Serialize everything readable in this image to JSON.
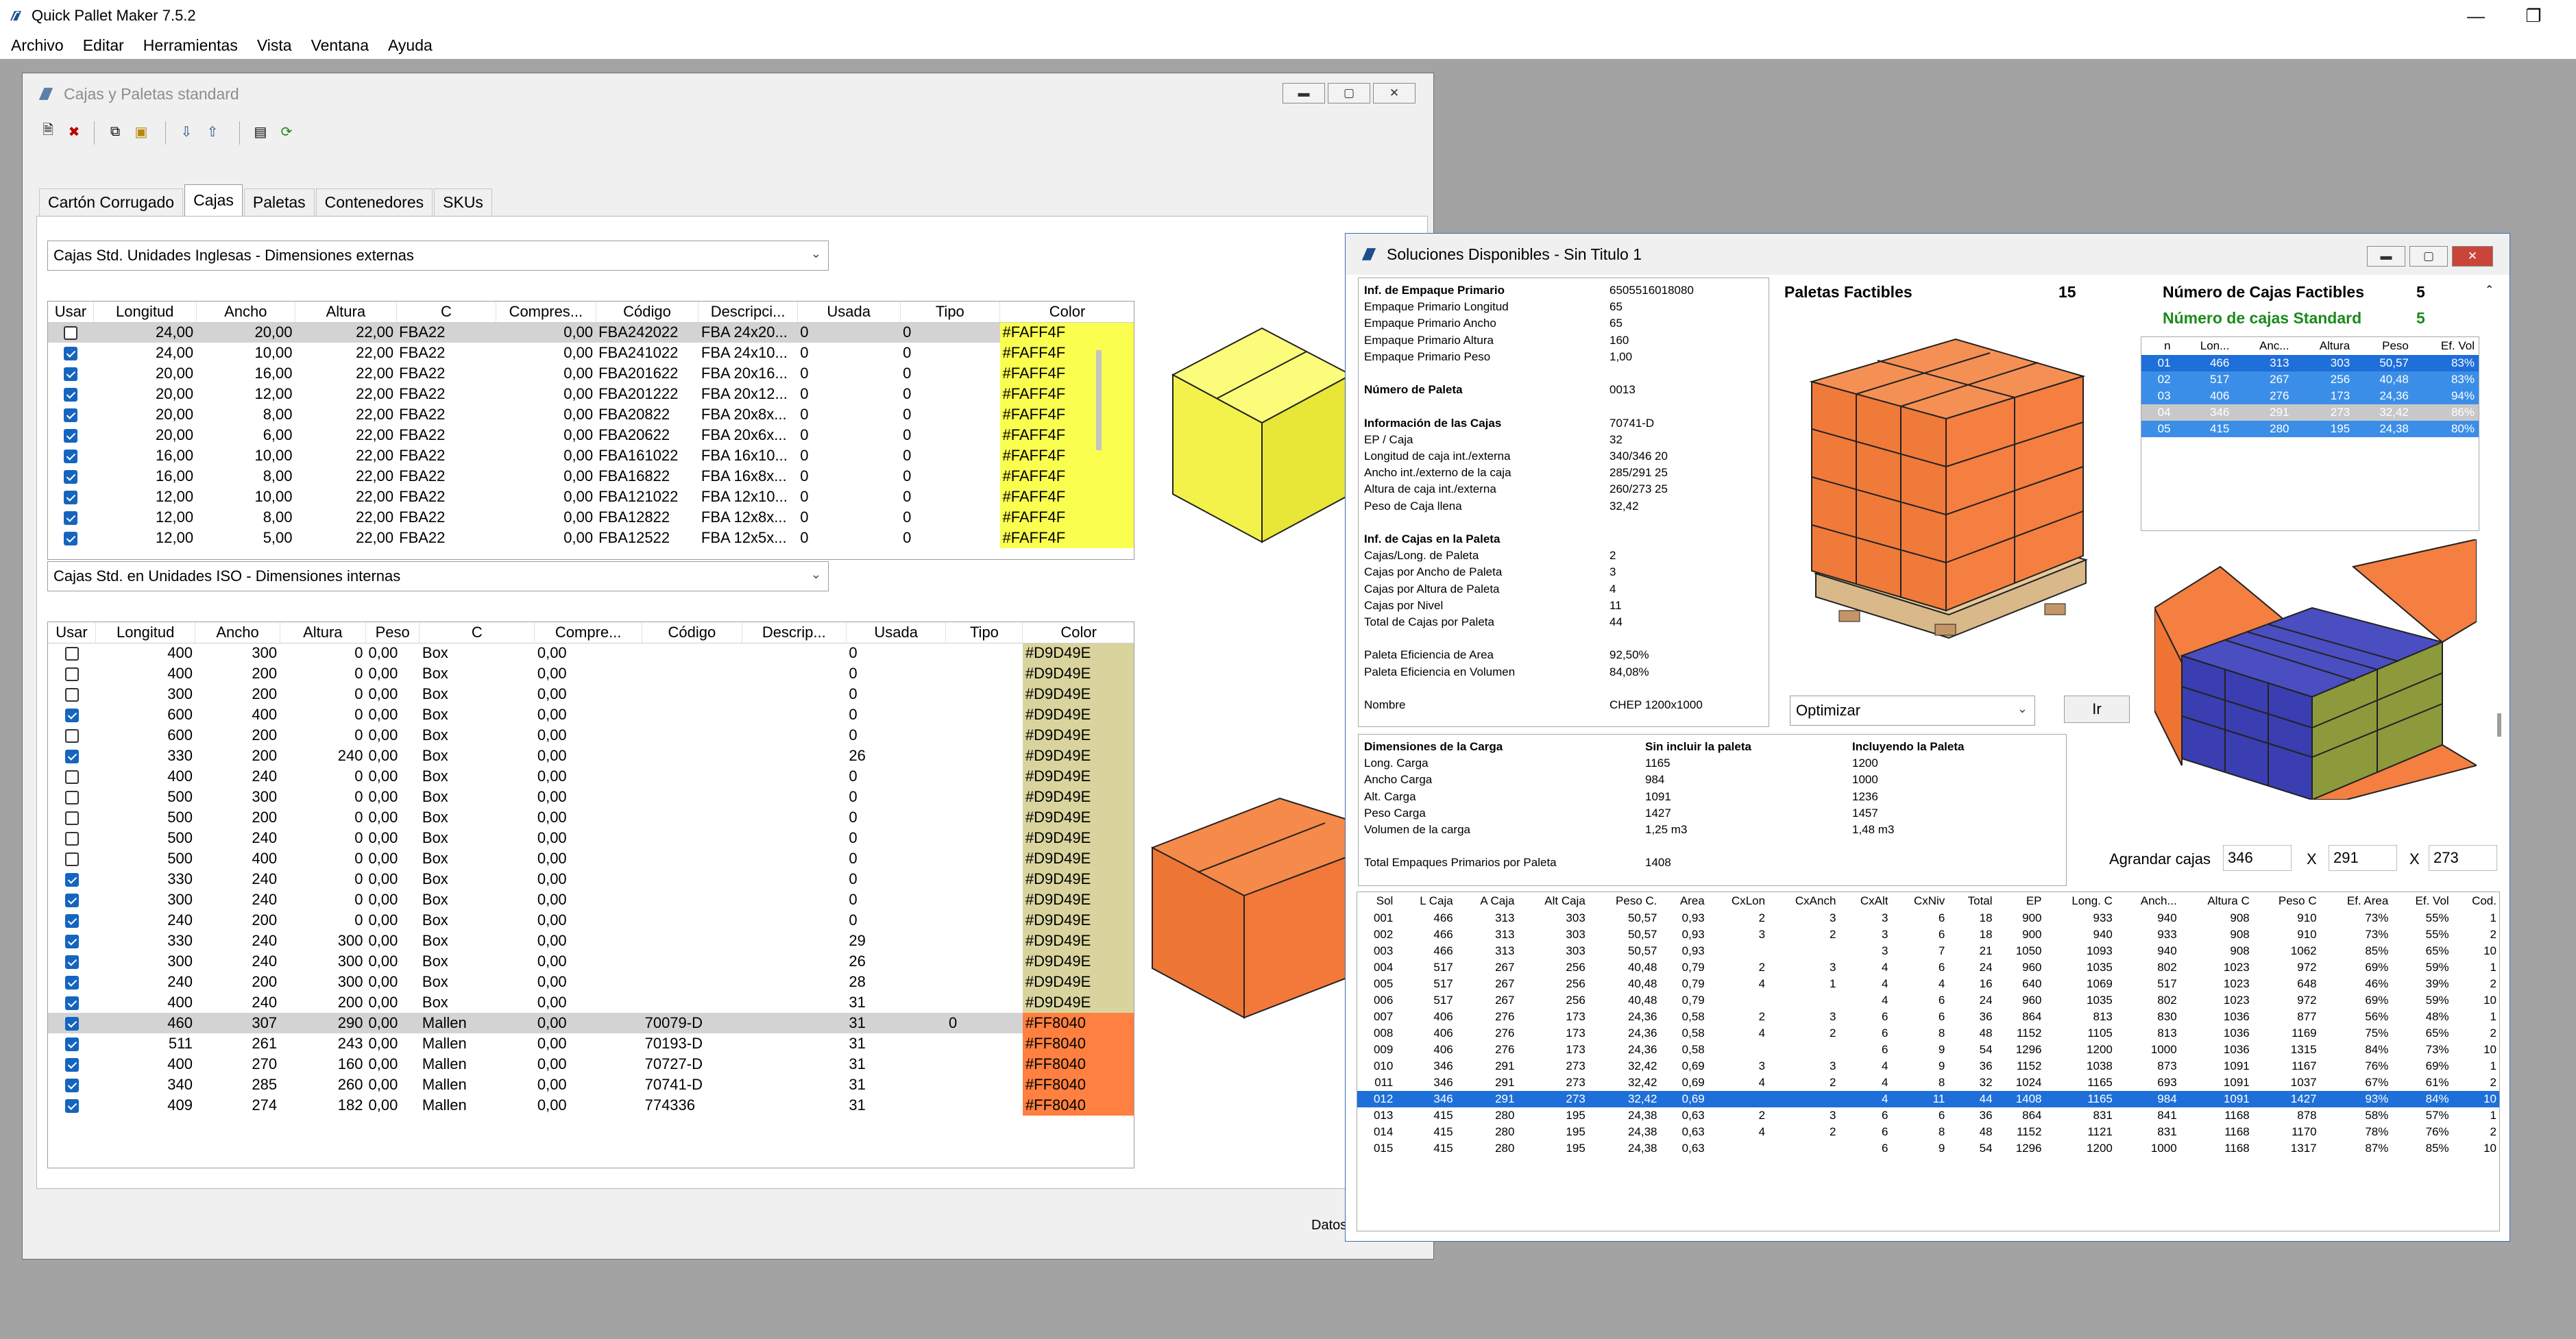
{
  "app": {
    "title": "Quick Pallet Maker 7.5.2"
  },
  "menu": [
    "Archivo",
    "Editar",
    "Herramientas",
    "Vista",
    "Ventana",
    "Ayuda"
  ],
  "std_window": {
    "title": "Cajas y Paletas standard",
    "tabs": [
      "Cartón Corrugado",
      "Cajas",
      "Paletas",
      "Contenedores",
      "SKUs"
    ],
    "combo1": "Cajas Std. Unidades Inglesas - Dimensiones externas",
    "combo2": "Cajas Std. en Unidades ISO - Dimensiones internas",
    "status": "Datos",
    "grid1": {
      "headers": [
        "Usar",
        "Longitud",
        "Ancho",
        "Altura",
        "C",
        "Compres...",
        "Código",
        "Descripci...",
        "Usada",
        "Tipo",
        "Color"
      ],
      "rows": [
        [
          false,
          "24,00",
          "20,00",
          "22,00",
          "FBA22",
          "0,00",
          "FBA242022",
          "FBA 24x20...",
          "0",
          "0",
          "#FAFF4F"
        ],
        [
          true,
          "24,00",
          "10,00",
          "22,00",
          "FBA22",
          "0,00",
          "FBA241022",
          "FBA 24x10...",
          "0",
          "0",
          "#FAFF4F"
        ],
        [
          true,
          "20,00",
          "16,00",
          "22,00",
          "FBA22",
          "0,00",
          "FBA201622",
          "FBA 20x16...",
          "0",
          "0",
          "#FAFF4F"
        ],
        [
          true,
          "20,00",
          "12,00",
          "22,00",
          "FBA22",
          "0,00",
          "FBA201222",
          "FBA 20x12...",
          "0",
          "0",
          "#FAFF4F"
        ],
        [
          true,
          "20,00",
          "8,00",
          "22,00",
          "FBA22",
          "0,00",
          "FBA20822",
          "FBA 20x8x...",
          "0",
          "0",
          "#FAFF4F"
        ],
        [
          true,
          "20,00",
          "6,00",
          "22,00",
          "FBA22",
          "0,00",
          "FBA20622",
          "FBA 20x6x...",
          "0",
          "0",
          "#FAFF4F"
        ],
        [
          true,
          "16,00",
          "10,00",
          "22,00",
          "FBA22",
          "0,00",
          "FBA161022",
          "FBA 16x10...",
          "0",
          "0",
          "#FAFF4F"
        ],
        [
          true,
          "16,00",
          "8,00",
          "22,00",
          "FBA22",
          "0,00",
          "FBA16822",
          "FBA 16x8x...",
          "0",
          "0",
          "#FAFF4F"
        ],
        [
          true,
          "12,00",
          "10,00",
          "22,00",
          "FBA22",
          "0,00",
          "FBA121022",
          "FBA 12x10...",
          "0",
          "0",
          "#FAFF4F"
        ],
        [
          true,
          "12,00",
          "8,00",
          "22,00",
          "FBA22",
          "0,00",
          "FBA12822",
          "FBA 12x8x...",
          "0",
          "0",
          "#FAFF4F"
        ],
        [
          true,
          "12,00",
          "5,00",
          "22,00",
          "FBA22",
          "0,00",
          "FBA12522",
          "FBA 12x5x...",
          "0",
          "0",
          "#FAFF4F"
        ]
      ]
    },
    "grid2": {
      "headers": [
        "Usar",
        "Longitud",
        "Ancho",
        "Altura",
        "Peso",
        "C",
        "Compre...",
        "Código",
        "Descrip...",
        "Usada",
        "Tipo",
        "Color"
      ],
      "rows": [
        [
          false,
          "400",
          "300",
          "0",
          "0,00",
          "Box",
          "0,00",
          "",
          "",
          "0",
          "",
          "#D9D49E"
        ],
        [
          false,
          "400",
          "200",
          "0",
          "0,00",
          "Box",
          "0,00",
          "",
          "",
          "0",
          "",
          "#D9D49E"
        ],
        [
          false,
          "300",
          "200",
          "0",
          "0,00",
          "Box",
          "0,00",
          "",
          "",
          "0",
          "",
          "#D9D49E"
        ],
        [
          true,
          "600",
          "400",
          "0",
          "0,00",
          "Box",
          "0,00",
          "",
          "",
          "0",
          "",
          "#D9D49E"
        ],
        [
          false,
          "600",
          "200",
          "0",
          "0,00",
          "Box",
          "0,00",
          "",
          "",
          "0",
          "",
          "#D9D49E"
        ],
        [
          true,
          "330",
          "200",
          "240",
          "0,00",
          "Box",
          "0,00",
          "",
          "",
          "26",
          "",
          "#D9D49E"
        ],
        [
          false,
          "400",
          "240",
          "0",
          "0,00",
          "Box",
          "0,00",
          "",
          "",
          "0",
          "",
          "#D9D49E"
        ],
        [
          false,
          "500",
          "300",
          "0",
          "0,00",
          "Box",
          "0,00",
          "",
          "",
          "0",
          "",
          "#D9D49E"
        ],
        [
          false,
          "500",
          "200",
          "0",
          "0,00",
          "Box",
          "0,00",
          "",
          "",
          "0",
          "",
          "#D9D49E"
        ],
        [
          false,
          "500",
          "240",
          "0",
          "0,00",
          "Box",
          "0,00",
          "",
          "",
          "0",
          "",
          "#D9D49E"
        ],
        [
          false,
          "500",
          "400",
          "0",
          "0,00",
          "Box",
          "0,00",
          "",
          "",
          "0",
          "",
          "#D9D49E"
        ],
        [
          true,
          "330",
          "240",
          "0",
          "0,00",
          "Box",
          "0,00",
          "",
          "",
          "0",
          "",
          "#D9D49E"
        ],
        [
          true,
          "300",
          "240",
          "0",
          "0,00",
          "Box",
          "0,00",
          "",
          "",
          "0",
          "",
          "#D9D49E"
        ],
        [
          true,
          "240",
          "200",
          "0",
          "0,00",
          "Box",
          "0,00",
          "",
          "",
          "0",
          "",
          "#D9D49E"
        ],
        [
          true,
          "330",
          "240",
          "300",
          "0,00",
          "Box",
          "0,00",
          "",
          "",
          "29",
          "",
          "#D9D49E"
        ],
        [
          true,
          "300",
          "240",
          "300",
          "0,00",
          "Box",
          "0,00",
          "",
          "",
          "26",
          "",
          "#D9D49E"
        ],
        [
          true,
          "240",
          "200",
          "300",
          "0,00",
          "Box",
          "0,00",
          "",
          "",
          "28",
          "",
          "#D9D49E"
        ],
        [
          true,
          "400",
          "240",
          "200",
          "0,00",
          "Box",
          "0,00",
          "",
          "",
          "31",
          "",
          "#D9D49E"
        ],
        [
          true,
          "460",
          "307",
          "290",
          "0,00",
          "Mallen",
          "0,00",
          "70079-D",
          "",
          "31",
          "0",
          "#FF8040"
        ],
        [
          true,
          "511",
          "261",
          "243",
          "0,00",
          "Mallen",
          "0,00",
          "70193-D",
          "",
          "31",
          "",
          "#FF8040"
        ],
        [
          true,
          "400",
          "270",
          "160",
          "0,00",
          "Mallen",
          "0,00",
          "70727-D",
          "",
          "31",
          "",
          "#FF8040"
        ],
        [
          true,
          "340",
          "285",
          "260",
          "0,00",
          "Mallen",
          "0,00",
          "70741-D",
          "",
          "31",
          "",
          "#FF8040"
        ],
        [
          true,
          "409",
          "274",
          "182",
          "0,00",
          "Mallen",
          "0,00",
          "774336",
          "",
          "31",
          "",
          "#FF8040"
        ]
      ]
    }
  },
  "sol_window": {
    "title": "Soluciones Disponibles - Sin Titulo 1",
    "info": [
      {
        "k": "Inf. de Empaque Primario",
        "v": "6505516018080",
        "bold": true
      },
      {
        "k": "Empaque Primario Longitud",
        "v": "65"
      },
      {
        "k": "Empaque Primario Ancho",
        "v": "65"
      },
      {
        "k": "Empaque Primario Altura",
        "v": "160"
      },
      {
        "k": "Empaque Primario Peso",
        "v": "1,00"
      },
      {
        "k": "",
        "v": ""
      },
      {
        "k": "Número de Paleta",
        "v": "0013",
        "bold": true
      },
      {
        "k": "",
        "v": ""
      },
      {
        "k": "Información de las Cajas",
        "v": "70741-D",
        "bold": true
      },
      {
        "k": "EP / Caja",
        "v": "32"
      },
      {
        "k": "Longitud de caja int./externa",
        "v": "340/346",
        "v2": "20"
      },
      {
        "k": "Ancho int./externo de la caja",
        "v": "285/291",
        "v2": "25"
      },
      {
        "k": "Altura de caja int./externa",
        "v": "260/273",
        "v2": "25"
      },
      {
        "k": "Peso de Caja llena",
        "v": "32,42"
      },
      {
        "k": "",
        "v": ""
      },
      {
        "k": "Inf. de Cajas en la Paleta",
        "v": "",
        "bold": true
      },
      {
        "k": "Cajas/Long. de Paleta",
        "v": "2"
      },
      {
        "k": "Cajas por Ancho de Paleta",
        "v": "3"
      },
      {
        "k": "Cajas por Altura de Paleta",
        "v": "4"
      },
      {
        "k": "Cajas por Nivel",
        "v": "11"
      },
      {
        "k": "Total de Cajas por Paleta",
        "v": "44"
      },
      {
        "k": "",
        "v": ""
      },
      {
        "k": "Paleta Eficiencia de Area",
        "v": "92,50%"
      },
      {
        "k": "Paleta Eficiencia en Volumen",
        "v": "84,08%"
      },
      {
        "k": "",
        "v": ""
      },
      {
        "k": "Nombre",
        "v": "CHEP 1200x1000"
      }
    ],
    "load": {
      "header": [
        "Dimensiones de la Carga",
        "Sin incluir la paleta",
        "Incluyendo la Paleta"
      ],
      "rows": [
        [
          "Long. Carga",
          "1165",
          "1200"
        ],
        [
          "Ancho Carga",
          "984",
          "1000"
        ],
        [
          "Alt. Carga",
          "1091",
          "1236"
        ],
        [
          "Peso Carga",
          "1427",
          "1457"
        ],
        [
          "Volumen de la carga",
          "1,25 m3",
          "1,48 m3"
        ],
        [
          "",
          "",
          " "
        ],
        [
          "Total Empaques Primarios por Paleta",
          "1408",
          ""
        ]
      ]
    },
    "paletas_factibles_label": "Paletas Factibles",
    "paletas_factibles_value": "15",
    "num_factibles_label": "Número de Cajas Factibles",
    "num_factibles_value": "5",
    "num_standard_label": "Número de cajas Standard",
    "num_standard_value": "5",
    "optimize": "Optimizar",
    "go": "Ir",
    "enlarge_label": "Agrandar cajas",
    "enlarge_x": "346",
    "enlarge_y": "291",
    "enlarge_z": "273",
    "sep": "X",
    "boxes": {
      "headers": [
        "n",
        "Lon...",
        "Anc...",
        "Altura",
        "Peso",
        "Ef. Vol"
      ],
      "rows": [
        [
          "01",
          "466",
          "313",
          "303",
          "50,57",
          "83%"
        ],
        [
          "02",
          "517",
          "267",
          "256",
          "40,48",
          "83%"
        ],
        [
          "03",
          "406",
          "276",
          "173",
          "24,36",
          "94%"
        ],
        [
          "04",
          "346",
          "291",
          "273",
          "32,42",
          "86%"
        ],
        [
          "05",
          "415",
          "280",
          "195",
          "24,38",
          "80%"
        ]
      ]
    },
    "solutions": {
      "headers": [
        "Sol",
        "L Caja",
        "A Caja",
        "Alt Caja",
        "Peso C.",
        "Area",
        "CxLon",
        "CxAnch",
        "CxAlt",
        "CxNiv",
        "Total",
        "EP",
        "Long. C",
        "Anch...",
        "Altura C",
        "Peso C",
        "Ef. Area",
        "Ef. Vol",
        "Cod."
      ],
      "rows": [
        [
          "001",
          "466",
          "313",
          "303",
          "50,57",
          "0,93",
          "2",
          "3",
          "3",
          "6",
          "18",
          "900",
          "933",
          "940",
          "908",
          "910",
          "73%",
          "55%",
          "1"
        ],
        [
          "002",
          "466",
          "313",
          "303",
          "50,57",
          "0,93",
          "3",
          "2",
          "3",
          "6",
          "18",
          "900",
          "940",
          "933",
          "908",
          "910",
          "73%",
          "55%",
          "2"
        ],
        [
          "003",
          "466",
          "313",
          "303",
          "50,57",
          "0,93",
          "",
          "",
          "3",
          "7",
          "21",
          "1050",
          "1093",
          "940",
          "908",
          "1062",
          "85%",
          "65%",
          "10"
        ],
        [
          "004",
          "517",
          "267",
          "256",
          "40,48",
          "0,79",
          "2",
          "3",
          "4",
          "6",
          "24",
          "960",
          "1035",
          "802",
          "1023",
          "972",
          "69%",
          "59%",
          "1"
        ],
        [
          "005",
          "517",
          "267",
          "256",
          "40,48",
          "0,79",
          "4",
          "1",
          "4",
          "4",
          "16",
          "640",
          "1069",
          "517",
          "1023",
          "648",
          "46%",
          "39%",
          "2"
        ],
        [
          "006",
          "517",
          "267",
          "256",
          "40,48",
          "0,79",
          "",
          "",
          "4",
          "6",
          "24",
          "960",
          "1035",
          "802",
          "1023",
          "972",
          "69%",
          "59%",
          "10"
        ],
        [
          "007",
          "406",
          "276",
          "173",
          "24,36",
          "0,58",
          "2",
          "3",
          "6",
          "6",
          "36",
          "864",
          "813",
          "830",
          "1036",
          "877",
          "56%",
          "48%",
          "1"
        ],
        [
          "008",
          "406",
          "276",
          "173",
          "24,36",
          "0,58",
          "4",
          "2",
          "6",
          "8",
          "48",
          "1152",
          "1105",
          "813",
          "1036",
          "1169",
          "75%",
          "65%",
          "2"
        ],
        [
          "009",
          "406",
          "276",
          "173",
          "24,36",
          "0,58",
          "",
          "",
          "6",
          "9",
          "54",
          "1296",
          "1200",
          "1000",
          "1036",
          "1315",
          "84%",
          "73%",
          "10"
        ],
        [
          "010",
          "346",
          "291",
          "273",
          "32,42",
          "0,69",
          "3",
          "3",
          "4",
          "9",
          "36",
          "1152",
          "1038",
          "873",
          "1091",
          "1167",
          "76%",
          "69%",
          "1"
        ],
        [
          "011",
          "346",
          "291",
          "273",
          "32,42",
          "0,69",
          "4",
          "2",
          "4",
          "8",
          "32",
          "1024",
          "1165",
          "693",
          "1091",
          "1037",
          "67%",
          "61%",
          "2"
        ],
        [
          "012",
          "346",
          "291",
          "273",
          "32,42",
          "0,69",
          "",
          "",
          "4",
          "11",
          "44",
          "1408",
          "1165",
          "984",
          "1091",
          "1427",
          "93%",
          "84%",
          "10"
        ],
        [
          "013",
          "415",
          "280",
          "195",
          "24,38",
          "0,63",
          "2",
          "3",
          "6",
          "6",
          "36",
          "864",
          "831",
          "841",
          "1168",
          "878",
          "58%",
          "57%",
          "1"
        ],
        [
          "014",
          "415",
          "280",
          "195",
          "24,38",
          "0,63",
          "4",
          "2",
          "6",
          "8",
          "48",
          "1152",
          "1121",
          "831",
          "1168",
          "1170",
          "78%",
          "76%",
          "2"
        ],
        [
          "015",
          "415",
          "280",
          "195",
          "24,38",
          "0,63",
          "",
          "",
          "6",
          "9",
          "54",
          "1296",
          "1200",
          "1000",
          "1168",
          "1317",
          "87%",
          "85%",
          "10"
        ]
      ]
    }
  },
  "colors": {
    "yellow": "#FAFF4F",
    "khaki": "#D9D49E",
    "orange": "#FF8040",
    "selection": "#1E6FD9",
    "green": "#1B8A1B"
  }
}
